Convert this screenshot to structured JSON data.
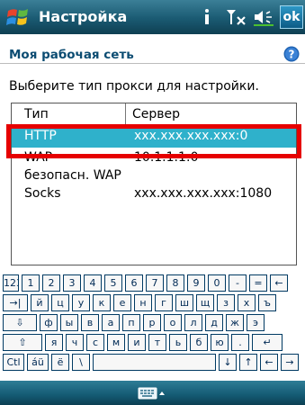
{
  "titlebar": {
    "title": "Настройка",
    "ok_label": "ok"
  },
  "header": {
    "title": "Моя рабочая сеть"
  },
  "instruction": "Выберите тип прокси для настройки.",
  "list": {
    "columns": [
      "Тип",
      "Сервер"
    ],
    "rows": [
      {
        "type": "HTTP",
        "server": "xxx.xxx.xxx.xxx:0",
        "selected": true
      },
      {
        "type": "WAP",
        "server": "10.1.1.1:0",
        "selected": false
      },
      {
        "type": "безопасн. WAP",
        "server": "",
        "selected": false
      },
      {
        "type": "Socks",
        "server": "xxx.xxx.xxx.xxx:1080",
        "selected": false
      }
    ]
  },
  "keyboard": {
    "rows": [
      [
        "123",
        "1",
        "2",
        "3",
        "4",
        "5",
        "6",
        "7",
        "8",
        "9",
        "0",
        "-",
        "=",
        "←"
      ],
      [
        "→|",
        "й",
        "ц",
        "у",
        "к",
        "е",
        "н",
        "г",
        "ш",
        "щ",
        "з",
        "х",
        "ъ"
      ],
      [
        "⇩",
        "ф",
        "ы",
        "в",
        "а",
        "п",
        "р",
        "о",
        "л",
        "д",
        "ж",
        "э"
      ],
      [
        "⇧",
        "я",
        "ч",
        "с",
        "м",
        "и",
        "т",
        "ь",
        "б",
        "ю",
        ".",
        "↵"
      ],
      [
        "Ctl",
        "áü",
        "ё",
        "\\",
        " ",
        "↓",
        "↑",
        "←",
        "→"
      ]
    ]
  },
  "colors": {
    "selected_row": "#2fb1cb",
    "highlight": "#e60000",
    "titlebar": "#1a5a72"
  },
  "icons": [
    "windows-start-icon",
    "info-icon",
    "signal-icon",
    "volume-icon",
    "help-icon",
    "keyboard-icon"
  ]
}
